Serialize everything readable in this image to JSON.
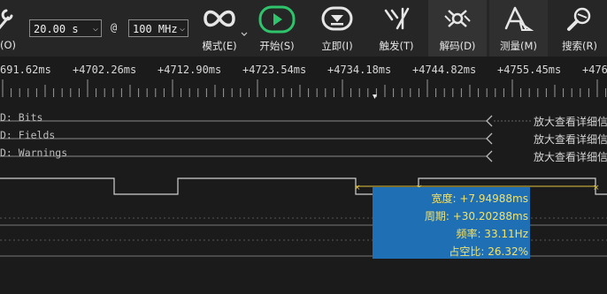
{
  "toolbar": {
    "settings_label": "(O)",
    "time_select": "20.00 s",
    "at": "@",
    "rate_select": "100 MHz",
    "mode_label": "模式(E)",
    "start_label": "开始(S)",
    "immediate_label": "立即(I)",
    "trigger_label": "触发(T)",
    "decode_label": "解码(D)",
    "measure_label": "测量(M)",
    "search_label": "搜索(R)",
    "colors": {
      "start_green": "#2fc46b",
      "icon": "#e6e6e6"
    }
  },
  "ruler": {
    "labels": [
      "691.62ms",
      "+4702.26ms",
      "+4712.90ms",
      "+4723.54ms",
      "+4734.18ms",
      "+4744.82ms",
      "+4755.45ms",
      "+476"
    ]
  },
  "channels": [
    {
      "label": "D: Bits",
      "hint": "放大查看详细信"
    },
    {
      "label": "D: Fields",
      "hint": "放大查看详细信"
    },
    {
      "label": "D: Warnings",
      "hint": "放大查看详细信"
    }
  ],
  "measurement": {
    "width": "宽度: +7.94988ms",
    "period": "周期: +30.20288ms",
    "frequency": "频率: 33.11Hz",
    "duty": "占空比: 26.32%",
    "colors": {
      "box": "#1f6fb5",
      "text": "#f3e26a"
    }
  }
}
